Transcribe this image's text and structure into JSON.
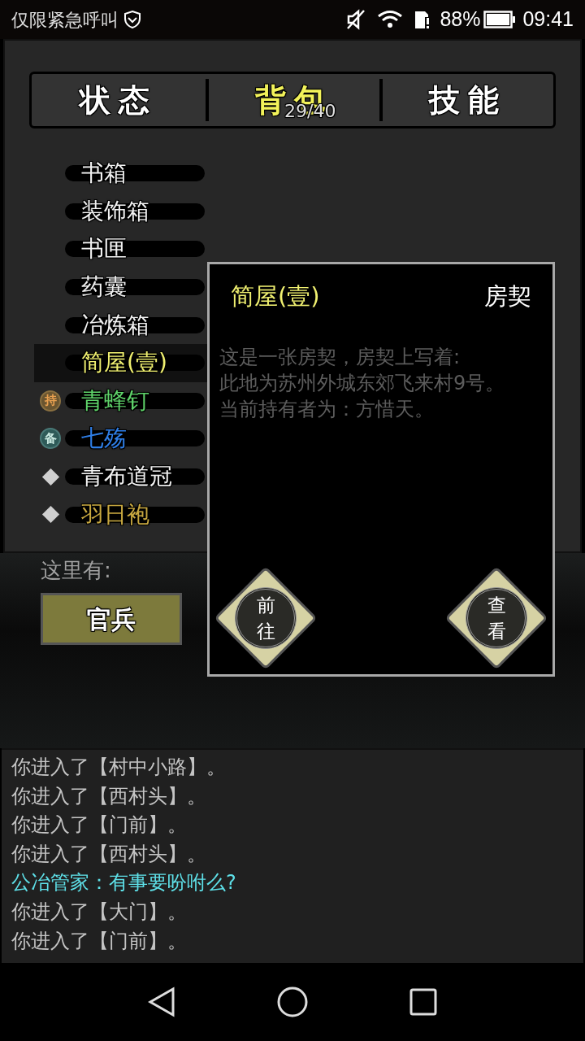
{
  "status_bar": {
    "carrier": "仅限紧急呼叫",
    "battery": "88%",
    "time": "09:41"
  },
  "tabs": [
    {
      "label": "状态",
      "selected": false
    },
    {
      "label": "背包",
      "selected": true,
      "count": "29/40"
    },
    {
      "label": "技能",
      "selected": false
    }
  ],
  "items": [
    {
      "name": "书箱",
      "kind": "plain",
      "color": "#f2f2f2",
      "selected": false
    },
    {
      "name": "装饰箱",
      "kind": "plain",
      "color": "#f2f2f2",
      "selected": false
    },
    {
      "name": "书匣",
      "kind": "plain",
      "color": "#f2f2f2",
      "selected": false
    },
    {
      "name": "药囊",
      "kind": "plain",
      "color": "#f2f2f2",
      "selected": false
    },
    {
      "name": "冶炼箱",
      "kind": "plain",
      "color": "#f2f2f2",
      "selected": false
    },
    {
      "name": "简屋(壹)",
      "kind": "plain",
      "color": "#f0f070",
      "selected": true
    },
    {
      "name": "青蜂钉",
      "kind": "held",
      "badge": "持",
      "color": "#5fd36a",
      "selected": false
    },
    {
      "name": "七殇",
      "kind": "equipped",
      "badge": "备",
      "color": "#2f7fe8",
      "selected": false
    },
    {
      "name": "青布道冠",
      "kind": "diamond",
      "color": "#f2f2f2",
      "selected": false
    },
    {
      "name": "羽日袍",
      "kind": "diamond",
      "color": "#c8a840",
      "selected": false
    }
  ],
  "here": {
    "label": "这里有:",
    "npcs": [
      "官兵"
    ]
  },
  "popup": {
    "title": "简屋(壹)",
    "type": "房契",
    "description": [
      "这是一张房契，房契上写着:",
      "此地为苏州外城东郊飞来村9号。",
      "当前持有者为：方惜天。"
    ],
    "actions": [
      "前往",
      "查看"
    ]
  },
  "log": [
    {
      "kind": "system",
      "text": "你进入了【村中小路】。"
    },
    {
      "kind": "system",
      "text": "你进入了【西村头】。"
    },
    {
      "kind": "system",
      "text": "你进入了【门前】。"
    },
    {
      "kind": "system",
      "text": "你进入了【西村头】。"
    },
    {
      "kind": "speech",
      "text": "公冶管家：有事要吩咐么?"
    },
    {
      "kind": "system",
      "text": "你进入了【大门】。"
    },
    {
      "kind": "system",
      "text": "你进入了【门前】。"
    }
  ]
}
